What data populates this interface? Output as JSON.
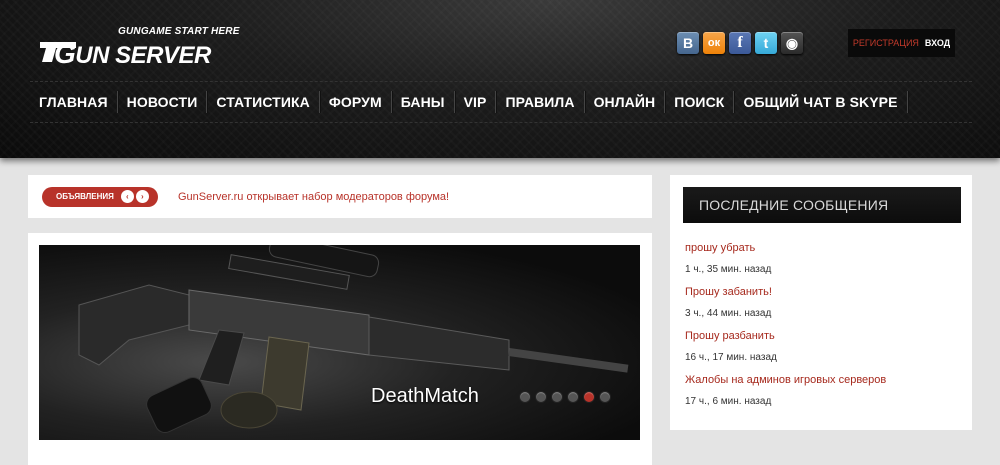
{
  "header": {
    "logo": {
      "tagline": "GUNGAME START HERE",
      "brand_first": "G",
      "brand_rest": "UN SERVER"
    },
    "social_icons": [
      {
        "name": "vk-icon",
        "glyph": "В",
        "color": "#45668e"
      },
      {
        "name": "odnoklassniki-icon",
        "glyph": "ок",
        "color": "#ee8208"
      },
      {
        "name": "facebook-icon",
        "glyph": "f",
        "color": "#3b5998"
      },
      {
        "name": "twitter-icon",
        "glyph": "t",
        "color": "#36a9d8"
      },
      {
        "name": "steam-icon",
        "glyph": "◉",
        "color": "#2a2a2a"
      }
    ],
    "auth": {
      "register": "Регистрация",
      "login": "Вход"
    },
    "nav": [
      "Главная",
      "Новости",
      "Статистика",
      "Форум",
      "Баны",
      "VIP",
      "Правила",
      "Онлайн",
      "Поиск",
      "Общий чат в Skype"
    ]
  },
  "announcement": {
    "badge": "Объявления",
    "prev_icon": "‹",
    "next_icon": "›",
    "text": "GunServer.ru открывает набор модераторов форума!"
  },
  "slider": {
    "caption": "DeathMatch",
    "dots_count": 6,
    "active_dot": 5,
    "accent_color": "#b8332a"
  },
  "sidebar": {
    "title": "Последние сообщения",
    "posts": [
      {
        "title": "прошу убрать",
        "time": "1 ч., 35 мин. назад"
      },
      {
        "title": "Прошу забанить!",
        "time": "3 ч., 44 мин. назад"
      },
      {
        "title": "Прошу разбанить",
        "time": "16 ч., 17 мин. назад"
      },
      {
        "title": "Жалобы на админов игровых серверов",
        "time": "17 ч., 6 мин. назад"
      }
    ]
  }
}
